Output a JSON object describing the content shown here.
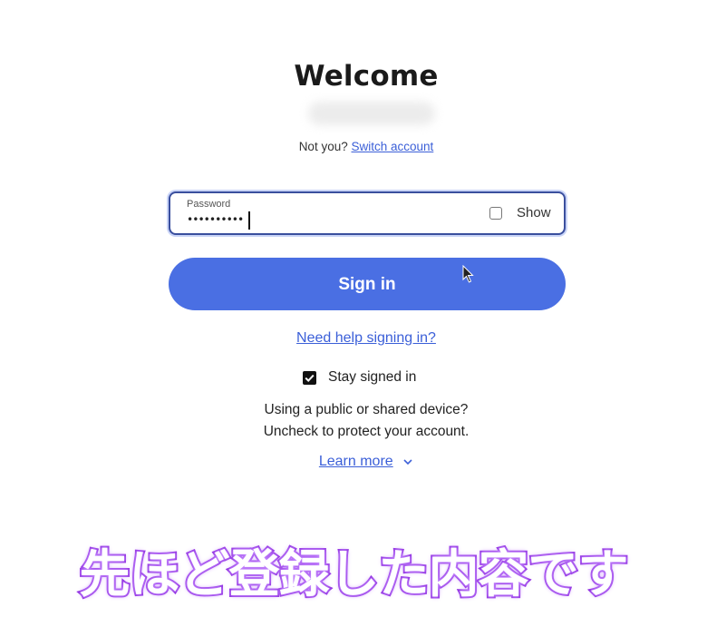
{
  "header": {
    "title": "Welcome",
    "not_you_text": "Not you?",
    "switch_account_link": "Switch account"
  },
  "password_field": {
    "label": "Password",
    "value": "••••••••••",
    "show_label": "Show",
    "show_checked": false
  },
  "signin_button": {
    "label": "Sign in",
    "color": "#4a6fe3"
  },
  "help": {
    "link": "Need help signing in?"
  },
  "stay_signed_in": {
    "label": "Stay signed in",
    "checked": true,
    "info_line1": "Using a public or shared device?",
    "info_line2": "Uncheck to protect your account."
  },
  "learn_more": {
    "label": "Learn more",
    "icon": "chevron-down-icon"
  },
  "caption": {
    "text": "先ほど登録した内容です",
    "color": "#8f2ee0"
  },
  "icons": {
    "cursor": "mouse-pointer-icon"
  },
  "colors": {
    "link": "#3b5fd8",
    "field_border": "#3a4f9e"
  }
}
